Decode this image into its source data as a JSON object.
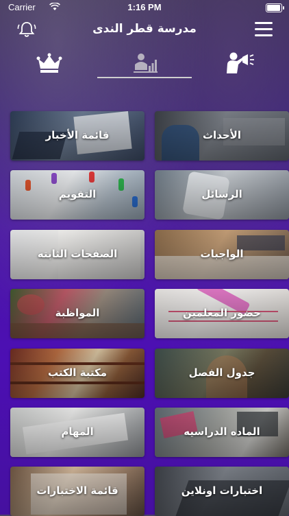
{
  "status_bar": {
    "carrier": "Carrier",
    "time": "1:16 PM"
  },
  "header": {
    "title": "مدرسة قطر الندى"
  },
  "icons": {
    "bell": "bell-icon",
    "menu": "hamburger-menu-icon",
    "tabs": [
      "crown-icon",
      "chart-icon",
      "speaker-icon"
    ]
  },
  "grid": {
    "items": [
      {
        "label": "قائمة الأخبار",
        "icon": "newspaper"
      },
      {
        "label": "الأحداث",
        "icon": "event"
      },
      {
        "label": "التقويم",
        "icon": "calendar"
      },
      {
        "label": "الرسائل",
        "icon": "messages"
      },
      {
        "label": "الصفحات الثابته",
        "icon": "pages"
      },
      {
        "label": "الواجبات",
        "icon": "homework"
      },
      {
        "label": "المواظبة",
        "icon": "attendance"
      },
      {
        "label": "حضور المعلمين",
        "icon": "teachers-attendance"
      },
      {
        "label": "مكتبة الكتب",
        "icon": "library"
      },
      {
        "label": "جدول الفصل",
        "icon": "class-schedule"
      },
      {
        "label": "المهام",
        "icon": "tasks"
      },
      {
        "label": "الماده الدراسيه",
        "icon": "subject"
      },
      {
        "label": "قائمة الاختبارات",
        "icon": "exams-list"
      },
      {
        "label": "اختبارات اونلاين",
        "icon": "online-exams"
      }
    ]
  },
  "colors": {
    "background_accent": "#4c0fb3",
    "tab_underline": "#cfcfcf"
  }
}
